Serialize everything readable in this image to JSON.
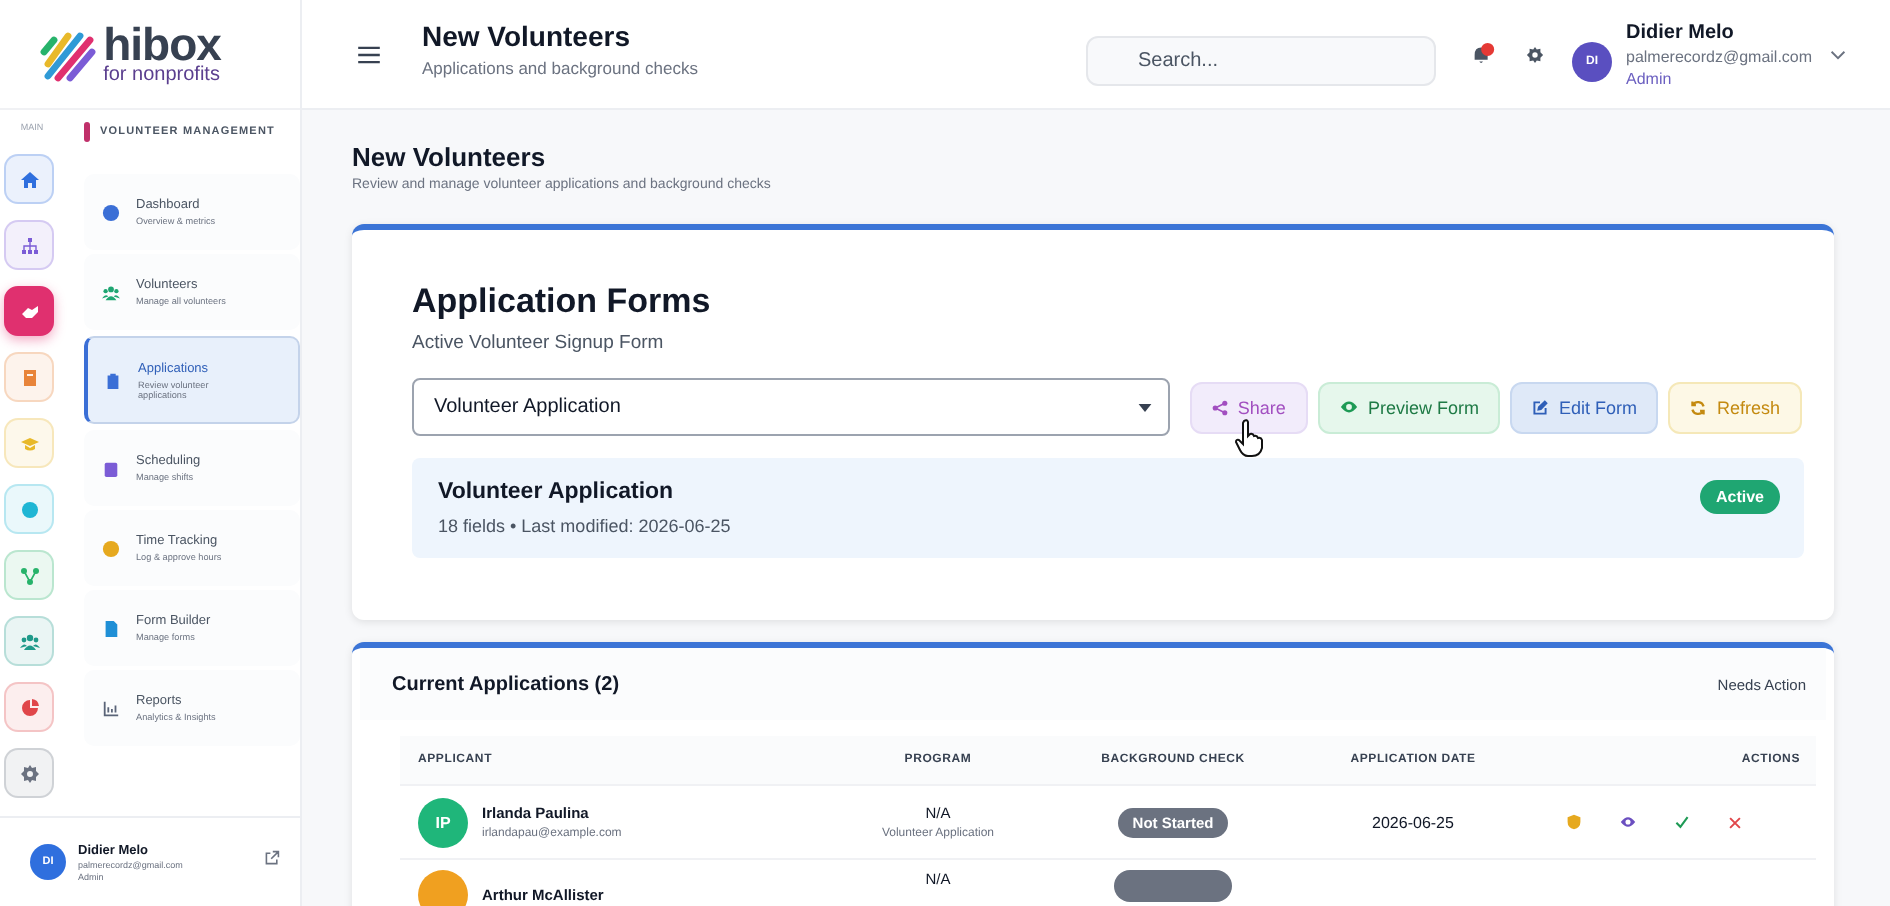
{
  "brand": {
    "name": "hibox",
    "tagline": "for nonprofits"
  },
  "rail": {
    "label": "MAIN",
    "items": [
      {
        "color": "#2f6fde",
        "selected": false
      },
      {
        "color": "#7b5cd6",
        "selected": false
      },
      {
        "color": "#e0306f",
        "selected": true
      },
      {
        "color": "#e8843a",
        "selected": false
      },
      {
        "color": "#e8b92a",
        "selected": false
      },
      {
        "color": "#1fb6d4",
        "selected": false
      },
      {
        "color": "#27b36b",
        "selected": false
      },
      {
        "color": "#1f9a8a",
        "selected": false
      },
      {
        "color": "#e0464a",
        "selected": false
      },
      {
        "color": "#6b7280",
        "selected": false
      }
    ]
  },
  "sidebar": {
    "section": "VOLUNTEER MANAGEMENT",
    "items": [
      {
        "title": "Dashboard",
        "subtitle": "Overview & metrics",
        "color": "#3b6fd6",
        "selected": false
      },
      {
        "title": "Volunteers",
        "subtitle": "Manage all volunteers",
        "color": "#1ea672",
        "selected": false
      },
      {
        "title": "Applications",
        "subtitle": "Review volunteer applications",
        "color": "#3b6fd6",
        "selected": true
      },
      {
        "title": "Scheduling",
        "subtitle": "Manage shifts",
        "color": "#7b5cd6",
        "selected": false
      },
      {
        "title": "Time Tracking",
        "subtitle": "Log & approve hours",
        "color": "#e6a91f",
        "selected": false
      },
      {
        "title": "Form Builder",
        "subtitle": "Manage forms",
        "color": "#1f8fd6",
        "selected": false
      },
      {
        "title": "Reports",
        "subtitle": "Analytics & Insights",
        "color": "#5a6478",
        "selected": false
      }
    ],
    "user": {
      "initials": "DI",
      "name": "Didier Melo",
      "email": "palmerecordz@gmail.com",
      "role": "Admin"
    }
  },
  "header": {
    "title": "New Volunteers",
    "subtitle": "Applications and background checks",
    "search": {
      "placeholder": "Search..."
    },
    "user": {
      "initials": "DI",
      "name": "Didier Melo",
      "email": "palmerecordz@gmail.com",
      "role": "Admin"
    }
  },
  "page": {
    "title": "New Volunteers",
    "subtitle": "Review and manage volunteer applications and background checks"
  },
  "forms": {
    "title": "Application Forms",
    "subtitle": "Active Volunteer Signup Form",
    "select": {
      "value": "Volunteer Application"
    },
    "buttons": [
      {
        "label": "Share",
        "kind": "share"
      },
      {
        "label": "Preview Form",
        "kind": "preview"
      },
      {
        "label": "Edit Form",
        "kind": "edit"
      },
      {
        "label": "Refresh",
        "kind": "refresh"
      }
    ],
    "active_form": {
      "name": "Volunteer Application",
      "meta": "18 fields • Last modified: 2026-06-25",
      "status": "Active"
    }
  },
  "applications": {
    "title": "Current Applications (2)",
    "filter": "Needs Action",
    "columns": [
      "APPLICANT",
      "PROGRAM",
      "BACKGROUND CHECK",
      "APPLICATION DATE",
      "ACTIONS"
    ],
    "rows": [
      {
        "initials": "IP",
        "color": "#1fb67a",
        "name": "Irlanda Paulina",
        "email": "irlandapau@example.com",
        "program": "N/A",
        "program_sub": "Volunteer Application",
        "check": "Not Started",
        "date": "2026-06-25"
      },
      {
        "color": "#f0a020",
        "name": "Arthur McAllister",
        "program": "N/A"
      }
    ]
  }
}
